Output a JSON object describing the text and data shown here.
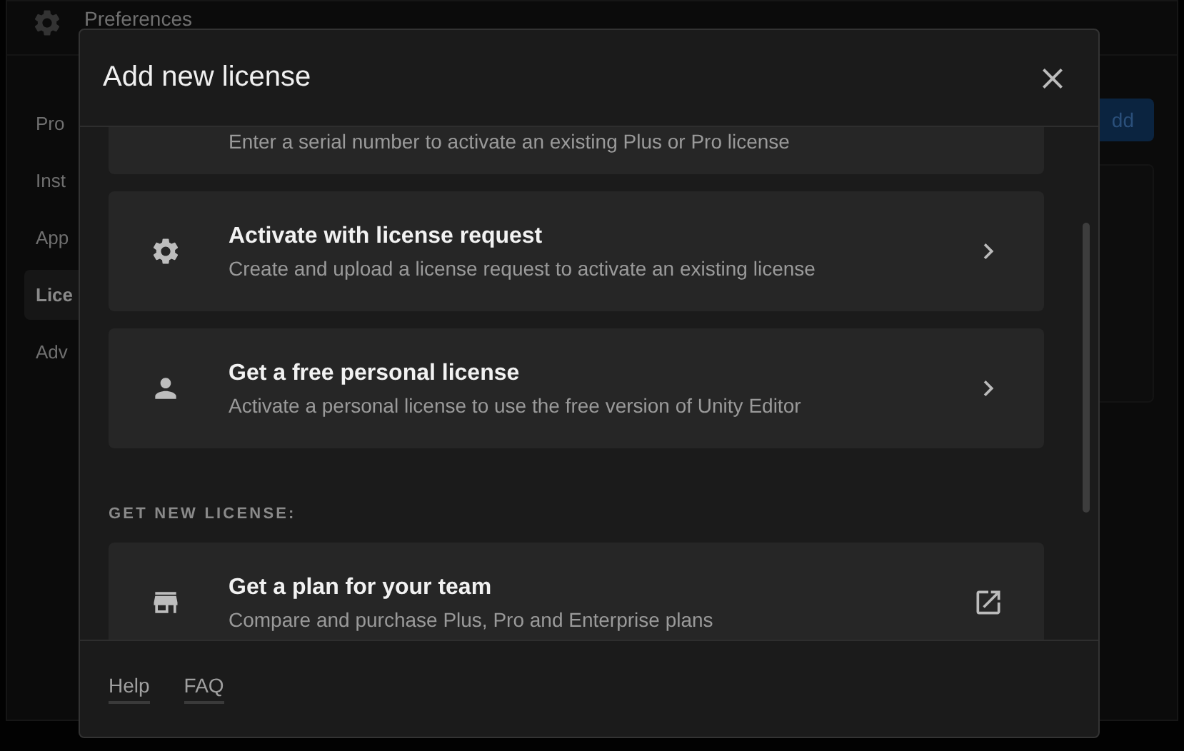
{
  "background": {
    "title": "Preferences",
    "sidebar": [
      {
        "label": "Pro",
        "selected": false
      },
      {
        "label": "Inst",
        "selected": false
      },
      {
        "label": "App",
        "selected": false
      },
      {
        "label": "Lice",
        "selected": true
      },
      {
        "label": "Adv",
        "selected": false
      }
    ],
    "button": "dd"
  },
  "dialog": {
    "title": "Add new license",
    "options": [
      {
        "description": "Enter a serial number to activate an existing Plus or Pro license"
      },
      {
        "kind": "chevron",
        "title": "Activate with license request",
        "description": "Create and upload a license request to activate an existing license"
      },
      {
        "kind": "chevron",
        "title": "Get a free personal license",
        "description": "Activate a personal license to use the free version of Unity Editor"
      }
    ],
    "get_new_license": {
      "heading": "GET NEW LICENSE:",
      "options": [
        {
          "kind": "external",
          "title": "Get a plan for your team",
          "description": "Compare and purchase Plus, Pro and Enterprise plans"
        }
      ]
    },
    "footer_links": [
      "Help",
      "FAQ"
    ]
  }
}
